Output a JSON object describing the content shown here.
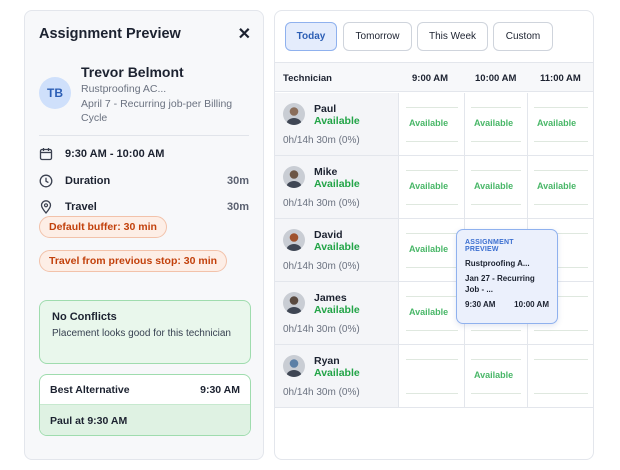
{
  "assignment_preview": {
    "title": "Assignment Preview",
    "close_icon": "close-icon",
    "client": {
      "initials": "TB",
      "name": "Trevor Belmont",
      "company": "Rustproofing AC...",
      "job": "April 7 - Recurring job-per Billing Cycle"
    },
    "time_range": "9:30 AM - 10:00 AM",
    "duration_label": "Duration",
    "duration_value": "30m",
    "travel_label": "Travel",
    "travel_value": "30m",
    "buffer_tag": "Default buffer: 30 min",
    "travel_tag": "Travel from previous stop: 30 min",
    "conflicts": {
      "title": "No Conflicts",
      "description": "Placement looks good for this technician"
    },
    "best_alternative": {
      "title": "Best Alternative",
      "time": "9:30 AM",
      "option": "Paul at 9:30 AM"
    }
  },
  "schedule": {
    "tabs": [
      {
        "label": "Today",
        "active": true
      },
      {
        "label": "Tomorrow",
        "active": false
      },
      {
        "label": "This Week",
        "active": false
      },
      {
        "label": "Custom",
        "active": false
      }
    ],
    "columns": [
      "Technician",
      "9:00 AM",
      "10:00 AM",
      "11:00 AM"
    ],
    "technicians": [
      {
        "name": "Paul",
        "status": "Available",
        "hours": "0h/14h 30m (0%)",
        "slots": [
          "Available",
          "Available",
          "Available"
        ]
      },
      {
        "name": "Mike",
        "status": "Available",
        "hours": "0h/14h 30m (0%)",
        "slots": [
          "Available",
          "Available",
          "Available"
        ]
      },
      {
        "name": "David",
        "status": "Available",
        "hours": "0h/14h 30m (0%)",
        "slots": [
          "Available",
          "",
          ""
        ]
      },
      {
        "name": "James",
        "status": "Available",
        "hours": "0h/14h 30m (0%)",
        "slots": [
          "Available",
          "",
          ""
        ]
      },
      {
        "name": "Ryan",
        "status": "Available",
        "hours": "0h/14h 30m (0%)",
        "slots": [
          "",
          "Available",
          ""
        ]
      }
    ],
    "preview_card": {
      "title": "ASSIGNMENT PREVIEW",
      "company": "Rustproofing A...",
      "job": "Jan 27 - Recurring Job - ...",
      "start": "9:30 AM",
      "end": "10:00 AM"
    }
  },
  "colors": {
    "accent_blue": "#2d5fb5",
    "available_green": "#22a447",
    "warning_orange": "#c2410c",
    "success_bg": "#e9f7ec"
  }
}
